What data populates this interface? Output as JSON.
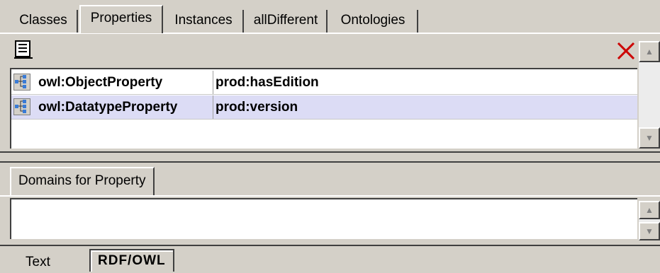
{
  "top_tabs": [
    {
      "label": "Classes",
      "active": false
    },
    {
      "label": "Properties",
      "active": true
    },
    {
      "label": "Instances",
      "active": false
    },
    {
      "label": "allDifferent",
      "active": false
    },
    {
      "label": "Ontologies",
      "active": false
    }
  ],
  "toolbar": {
    "list_icon": "list-icon",
    "delete_icon": "delete-x-icon"
  },
  "properties": [
    {
      "type": "owl:ObjectProperty",
      "name": "prod:hasEdition",
      "selected": false
    },
    {
      "type": "owl:DatatypeProperty",
      "name": "prod:version",
      "selected": true
    }
  ],
  "domains_tab": {
    "label": "Domains for Property"
  },
  "bottom_tabs": [
    {
      "label": "Text",
      "active": false
    },
    {
      "label": "RDF/OWL",
      "active": true
    }
  ],
  "colors": {
    "background": "#d4d0c8",
    "selected_row": "#dcdcf5",
    "delete_red": "#cc0000"
  }
}
